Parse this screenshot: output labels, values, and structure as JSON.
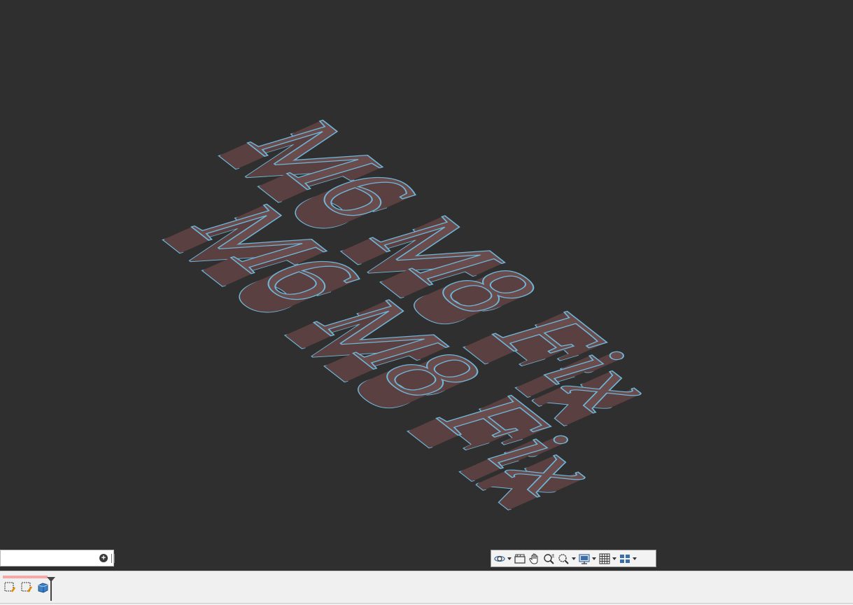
{
  "scene": {
    "text_objects": [
      {
        "text": "M6 M8 Fix",
        "font_size": 140,
        "angle": 0
      },
      {
        "text": "M6 M8 Fix",
        "font_size": 140,
        "angle": 0
      }
    ],
    "colors": {
      "background": "#2f2f2f",
      "face": "#6a4c4d",
      "side": "#5b4041",
      "edge": "#6fb6d8"
    }
  },
  "command_line": {
    "value": "",
    "placeholder": ""
  },
  "nav_toolbar": {
    "buttons": [
      {
        "name": "orbit-icon",
        "has_dropdown": true
      },
      {
        "name": "showmotion-icon",
        "has_dropdown": false
      },
      {
        "name": "pan-icon",
        "has_dropdown": false
      },
      {
        "name": "zoom-realtime-icon",
        "has_dropdown": false
      },
      {
        "name": "zoom-window-icon",
        "has_dropdown": true
      },
      {
        "name": "display-icon",
        "has_dropdown": true
      },
      {
        "name": "grid-icon",
        "has_dropdown": true
      },
      {
        "name": "viewports-icon",
        "has_dropdown": true
      }
    ]
  },
  "status_tools": [
    {
      "name": "select-window-icon"
    },
    {
      "name": "select-crossing-icon"
    },
    {
      "name": "solid-icon"
    }
  ]
}
